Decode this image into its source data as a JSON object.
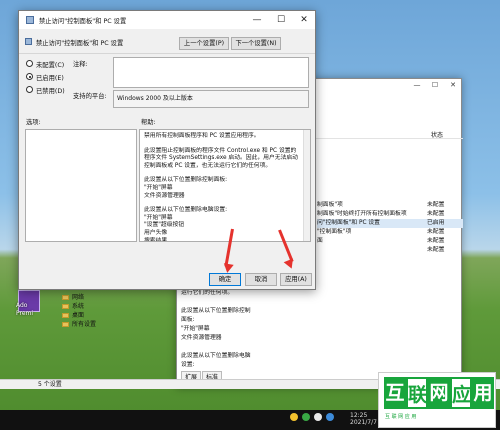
{
  "desktop": {
    "icon_label_1": "Ado",
    "icon_label_2": "Premi"
  },
  "background_window": {
    "status_header": "状态",
    "rows": [
      {
        "name": "制面板\"项",
        "status": "未配置"
      },
      {
        "name": "制面板\"时始终打开所有控制面板项",
        "status": "未配置"
      },
      {
        "name": "问\"控制面板\"和 PC 设置",
        "status": "已启用"
      },
      {
        "name": "\"控制面板\"项",
        "status": "未配置"
      },
      {
        "name": "面",
        "status": "未配置"
      },
      {
        "name": "",
        "status": "未配置"
      }
    ],
    "desc_lines": [
      "运行它们的任何项。",
      "",
      "此设置从以下位置删除控制",
      "面板:",
      "\"开始\"屏幕",
      "文件资源管理器",
      "",
      "此设置从以下位置删除电脑",
      "设置:"
    ],
    "tree": [
      "网络",
      "系统",
      "桌面",
      "所有设置"
    ],
    "tabs": [
      "扩展",
      "标准"
    ],
    "statusbar": "5 个设置",
    "clock_time": "12:25",
    "clock_date": "2021/7/7"
  },
  "watermark": {
    "chars": [
      "互",
      "联",
      "网",
      "应",
      "用"
    ],
    "sub": "互 联 网 应 用"
  },
  "dialog": {
    "title": "禁止访问\"控制面板\"和 PC 设置",
    "policy_name": "禁止访问\"控制面板\"和 PC 设置",
    "prev_button": "上一个设置(P)",
    "next_button": "下一个设置(N)",
    "radio_not_configured": "未配置(C)",
    "radio_enabled": "已启用(E)",
    "radio_disabled": "已禁用(D)",
    "selected_option": "已启用(E)",
    "comment_label": "注释:",
    "supported_label": "支持的平台:",
    "supported_value": "Windows 2000 及以上版本",
    "options_label": "选项:",
    "help_label": "帮助:",
    "help_paragraphs": [
      "禁用所有控制面板程序和 PC 设置应用程序。",
      "此设置阻止控制面板的程序文件 Control.exe 和 PC 设置的程序文件 SystemSettings.exe 启动。因此，用户无法启动控制面板或 PC 设置，也无法运行它们的任何项。",
      "此设置从以下位置删除控制面板:\n\"开始\"屏幕\n文件资源管理器",
      "此设置从以下位置删除电脑设置:\n\"开始\"屏幕\n\"设置\"超级按钮\n用户头像\n搜索结果"
    ],
    "ok_button": "确定",
    "cancel_button": "取消",
    "apply_button": "应用(A)",
    "window_controls": {
      "minimize": "—",
      "maximize": "☐",
      "close": "✕"
    }
  },
  "colors": {
    "annotation_arrow": "#e5322d",
    "watermark_green": "#18a53c",
    "accent": "#0078d7"
  }
}
